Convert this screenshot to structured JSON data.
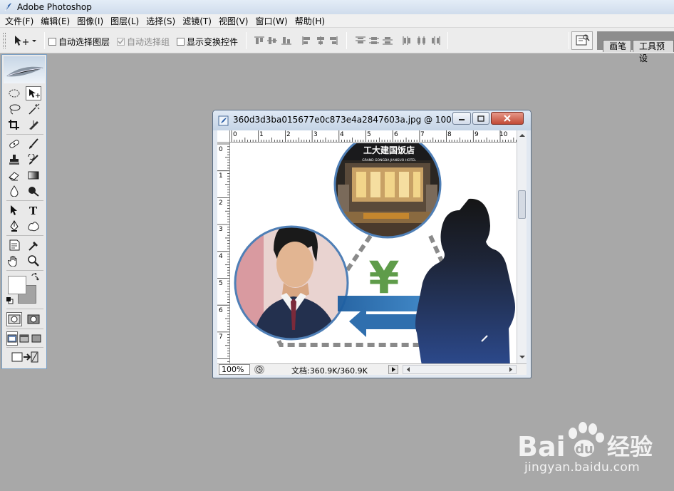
{
  "app": {
    "title": "Adobe Photoshop"
  },
  "menu": [
    "文件(F)",
    "编辑(E)",
    "图像(I)",
    "图层(L)",
    "选择(S)",
    "滤镜(T)",
    "视图(V)",
    "窗口(W)",
    "帮助(H)"
  ],
  "options": {
    "auto_select_layer": "自动选择图层",
    "auto_select_group": "自动选择组",
    "show_transform_controls": "显示变换控件",
    "auto_select_layer_checked": false,
    "auto_select_group_checked": true,
    "show_transform_controls_checked": false
  },
  "palette_tabs": [
    "画笔",
    "工具预设"
  ],
  "document": {
    "title": "360d3d3ba015677e0c873e4a2847603a.jpg @ 100...",
    "zoom": "100%",
    "doc_size": "文档:360.9K/360.9K",
    "ruler_h": [
      "0",
      "1",
      "2",
      "3",
      "4",
      "5",
      "6",
      "7",
      "8",
      "9",
      "10"
    ],
    "ruler_v": [
      "0",
      "1",
      "2",
      "3",
      "4",
      "5",
      "6",
      "7"
    ]
  },
  "image": {
    "hotel_sign_cn": "工大建国饭店",
    "hotel_sign_en": "GRAND GONGDA JIANGUO HOTEL",
    "currency_symbol": "¥"
  },
  "watermark": {
    "brand": "Bai",
    "brand_suffix": "经验",
    "url": "jingyan.baidu.com"
  },
  "colors": {
    "desktop": "#a8a8a8",
    "yen_green": "#5f9c4a",
    "arrow_blue": "#2f6fae",
    "silhouette_top": "#151515",
    "silhouette_bottom": "#2c4a8e"
  }
}
